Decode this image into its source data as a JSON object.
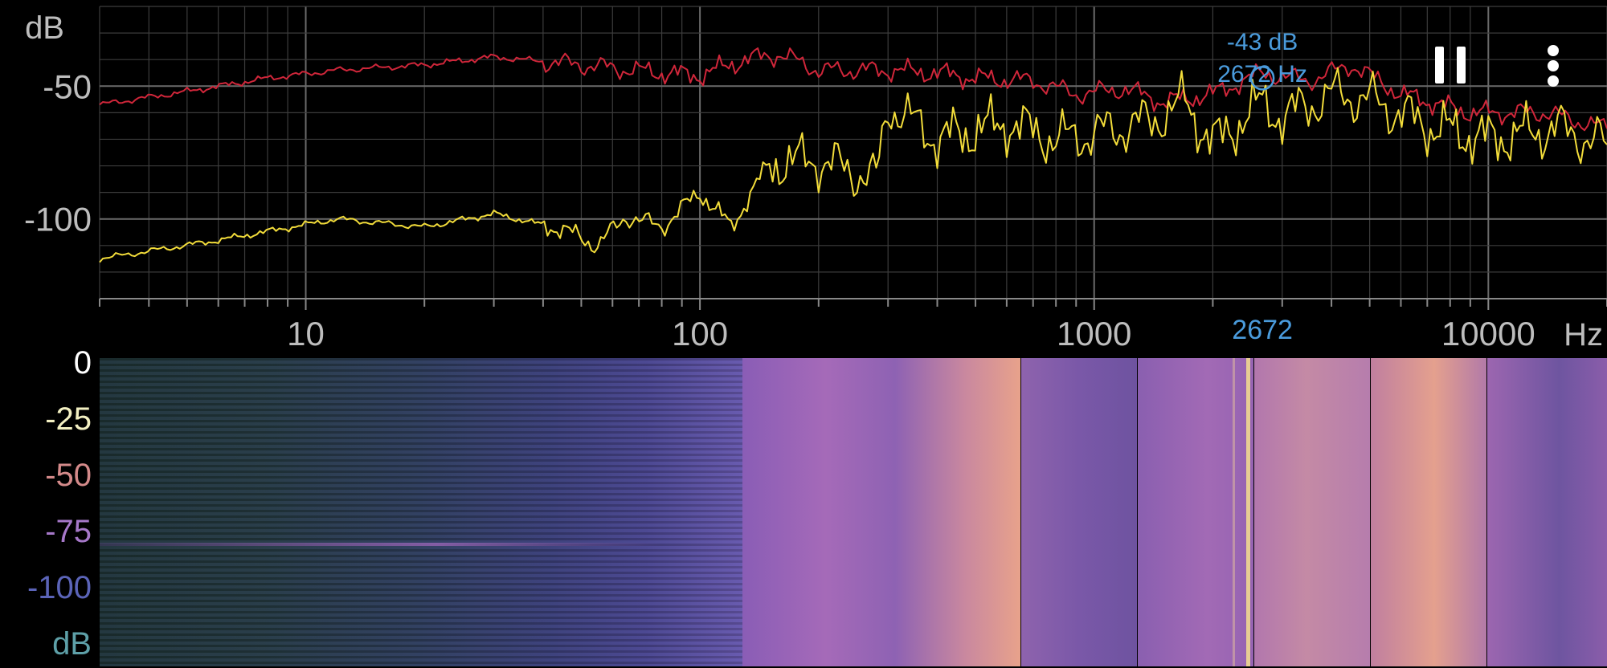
{
  "colors": {
    "background": "#000000",
    "grid": "#555555",
    "peak_hold_line": "#d0263a",
    "current_line": "#f2dc3a",
    "marker": "#4a9bdc",
    "axis_text": "#bdbdbd",
    "scale_colors": [
      "#ffffff",
      "#f3f0c2",
      "#d48a8a",
      "#a678c9",
      "#5b64b8",
      "#5ea0a8"
    ]
  },
  "spectrum": {
    "y_unit": "dB",
    "x_unit": "Hz",
    "marker": {
      "db_label": "-43 dB",
      "hz_label": "2672 Hz",
      "axis_label": "2672"
    }
  },
  "controls": {
    "pause_icon": "pause-icon",
    "menu_icon": "more-vert-icon"
  },
  "spectrogram": {
    "color_scale_labels": [
      "0",
      "-25",
      "-50",
      "-75",
      "-100"
    ],
    "unit": "dB"
  },
  "chart_data": {
    "type": "line",
    "x_scale": "log",
    "xlim": [
      3,
      20000
    ],
    "ylim": [
      -130,
      -20
    ],
    "x_tick_labels": [
      "10",
      "100",
      "1000",
      "10000"
    ],
    "y_tick_labels": [
      "-50",
      "-100"
    ],
    "x_ticks": [
      10,
      100,
      1000,
      10000
    ],
    "y_ticks": [
      -50,
      -100
    ],
    "grid": true,
    "series": [
      {
        "role": "peak_hold",
        "color": "#d0263a",
        "x": [
          3,
          5,
          8,
          12,
          20,
          30,
          50,
          80,
          100,
          130,
          160,
          200,
          300,
          400,
          500,
          700,
          900,
          1200,
          1500,
          2000,
          2672,
          3500,
          4500,
          6000,
          9000,
          14000,
          20000
        ],
        "y": [
          -57,
          -52,
          -47,
          -44,
          -42,
          -39,
          -42,
          -45,
          -46,
          -40,
          -38,
          -44,
          -44,
          -45,
          -47,
          -48,
          -53,
          -51,
          -56,
          -53,
          -45,
          -48,
          -42,
          -53,
          -60,
          -60,
          -66
        ]
      },
      {
        "role": "current",
        "color": "#f2dc3a",
        "x": [
          3,
          6,
          12,
          20,
          30,
          45,
          55,
          65,
          80,
          100,
          120,
          150,
          200,
          280,
          300,
          400,
          600,
          800,
          1000,
          1400,
          1700,
          2000,
          2672,
          3000,
          4000,
          5000,
          7000,
          10000,
          15000,
          20000
        ],
        "y": [
          -115,
          -108,
          -100,
          -103,
          -98,
          -104,
          -110,
          -99,
          -103,
          -90,
          -103,
          -79,
          -78,
          -85,
          -57,
          -70,
          -64,
          -70,
          -68,
          -63,
          -56,
          -72,
          -56,
          -62,
          -53,
          -55,
          -65,
          -70,
          -66,
          -72
        ]
      }
    ]
  }
}
